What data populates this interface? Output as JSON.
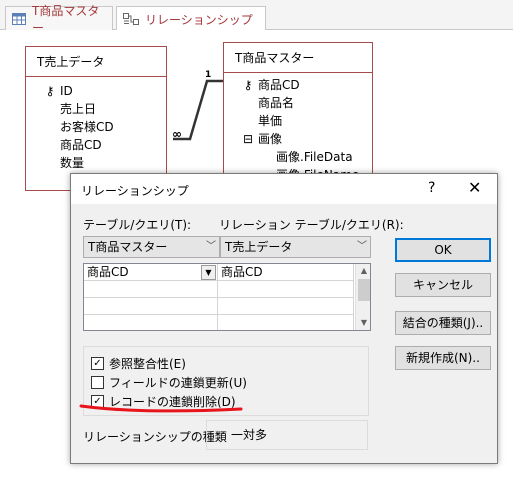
{
  "tabs": [
    {
      "label": "T商品マスター"
    },
    {
      "label": "リレーションシップ"
    }
  ],
  "tables": {
    "sales": {
      "title": "T売上データ",
      "fields": [
        "ID",
        "売上日",
        "お客様CD",
        "商品CD",
        "数量"
      ]
    },
    "products": {
      "title": "T商品マスター",
      "fields": [
        "商品CD",
        "商品名",
        "単価",
        "画像",
        "画像.FileData",
        "画像.FileName"
      ]
    }
  },
  "relation_line": {
    "one_label": "1",
    "many_label": "∞"
  },
  "dialog": {
    "title": "リレーションシップ",
    "help": "?",
    "close": "✕",
    "table_label": "テーブル/クエリ(T):",
    "related_label": "リレーション テーブル/クエリ(R):",
    "table_value": "T商品マスター",
    "related_value": "T売上データ",
    "grid_rows": [
      [
        "商品CD",
        "商品CD"
      ],
      [
        "",
        ""
      ],
      [
        "",
        ""
      ],
      [
        "",
        ""
      ]
    ],
    "checks": [
      {
        "label": "参照整合性(E)",
        "checked": true
      },
      {
        "label": "フィールドの連鎖更新(U)",
        "checked": false
      },
      {
        "label": "レコードの連鎖削除(D)",
        "checked": true
      }
    ],
    "kind_label": "リレーションシップの種類",
    "kind_value": "一対多",
    "buttons": {
      "ok": "OK",
      "cancel": "キャンセル",
      "join": "結合の種類(J)..",
      "create_new": "新規作成(N).."
    }
  },
  "colors": {
    "accent": "#a64b4b",
    "highlight": "#e8141c",
    "default_button_border": "#0078d7"
  }
}
